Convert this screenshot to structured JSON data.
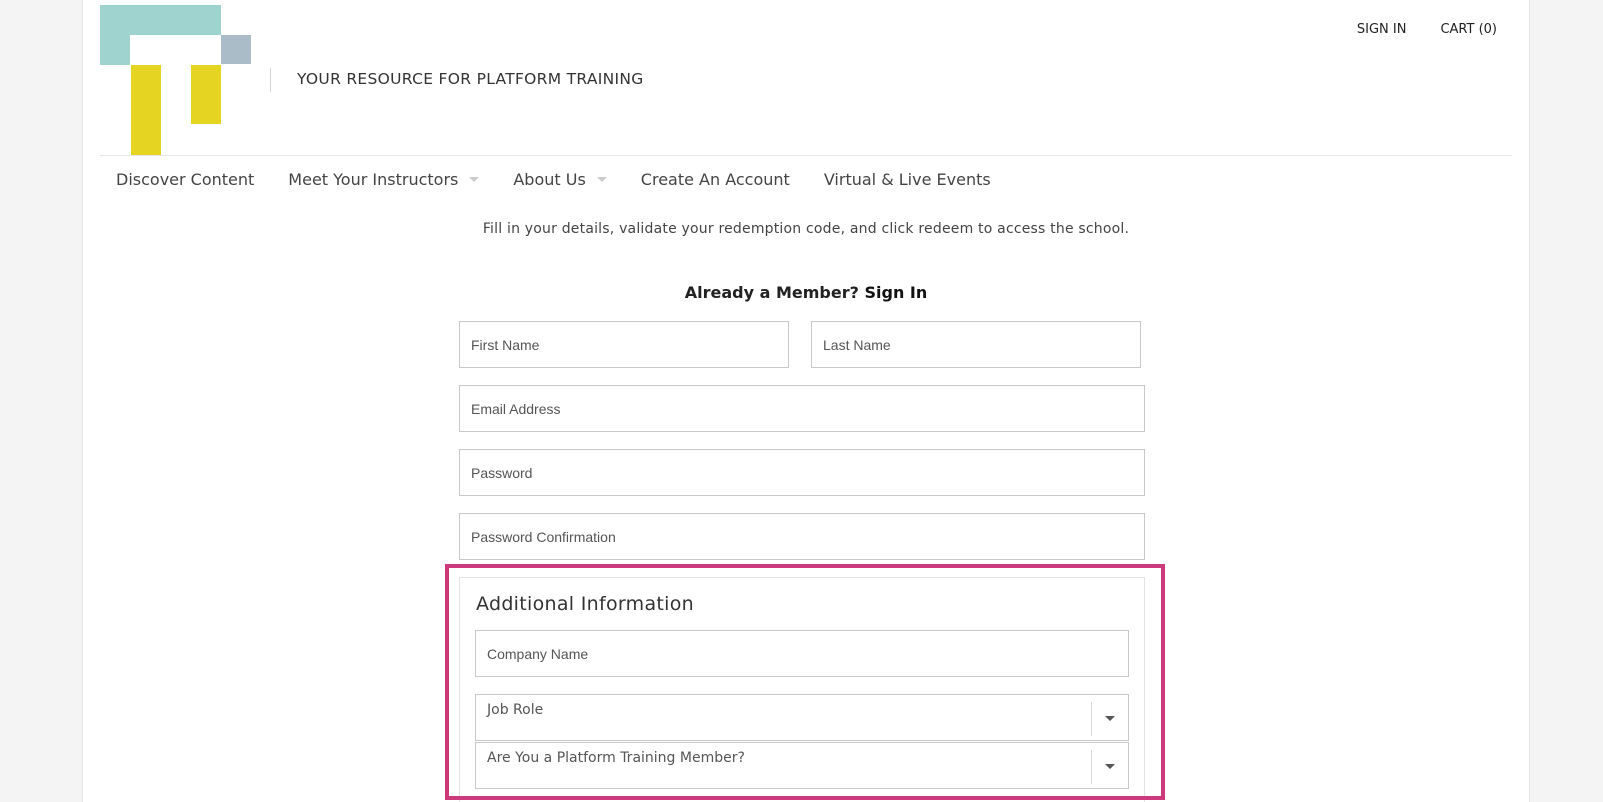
{
  "header": {
    "tagline": "YOUR RESOURCE FOR PLATFORM TRAINING",
    "sign_in": "SIGN IN",
    "cart": "CART (0)",
    "brand_colors": {
      "teal": "#9fd3cf",
      "grey": "#a9bcc7",
      "yellow": "#e6d423"
    }
  },
  "nav": {
    "items": [
      {
        "label": "Discover Content",
        "has_dropdown": false
      },
      {
        "label": "Meet Your Instructors",
        "has_dropdown": true
      },
      {
        "label": "About Us",
        "has_dropdown": true
      },
      {
        "label": "Create An Account",
        "has_dropdown": false
      },
      {
        "label": "Virtual & Live Events",
        "has_dropdown": false
      }
    ]
  },
  "content": {
    "intro": "Fill in your details, validate your redemption code, and click redeem to access the school.",
    "member_prompt": "Already a Member?",
    "member_sign_in": "Sign In"
  },
  "form": {
    "first_name": {
      "placeholder": "First Name",
      "value": ""
    },
    "last_name": {
      "placeholder": "Last Name",
      "value": ""
    },
    "email": {
      "placeholder": "Email Address",
      "value": ""
    },
    "password": {
      "placeholder": "Password",
      "value": ""
    },
    "password_confirmation": {
      "placeholder": "Password Confirmation",
      "value": ""
    }
  },
  "additional": {
    "title": "Additional Information",
    "company": {
      "placeholder": "Company Name",
      "value": ""
    },
    "job_role": {
      "label": "Job Role"
    },
    "platform_member": {
      "label": "Are You a Platform Training Member?"
    },
    "highlight_color": "#cc3a7c"
  }
}
